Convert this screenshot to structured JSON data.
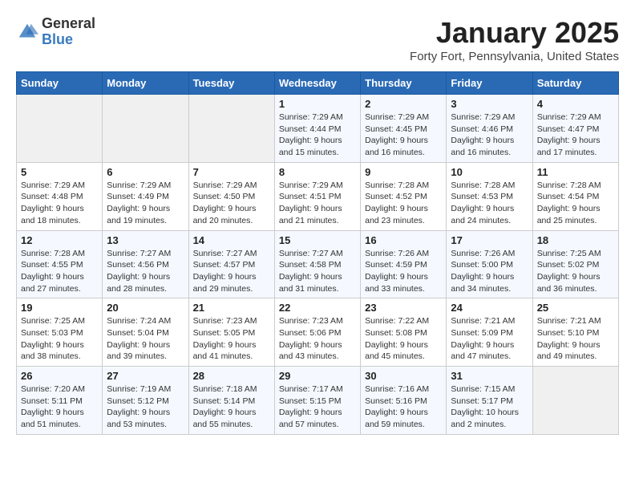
{
  "logo": {
    "general": "General",
    "blue": "Blue"
  },
  "title": "January 2025",
  "location": "Forty Fort, Pennsylvania, United States",
  "weekdays": [
    "Sunday",
    "Monday",
    "Tuesday",
    "Wednesday",
    "Thursday",
    "Friday",
    "Saturday"
  ],
  "weeks": [
    [
      {
        "day": "",
        "info": ""
      },
      {
        "day": "",
        "info": ""
      },
      {
        "day": "",
        "info": ""
      },
      {
        "day": "1",
        "info": "Sunrise: 7:29 AM\nSunset: 4:44 PM\nDaylight: 9 hours\nand 15 minutes."
      },
      {
        "day": "2",
        "info": "Sunrise: 7:29 AM\nSunset: 4:45 PM\nDaylight: 9 hours\nand 16 minutes."
      },
      {
        "day": "3",
        "info": "Sunrise: 7:29 AM\nSunset: 4:46 PM\nDaylight: 9 hours\nand 16 minutes."
      },
      {
        "day": "4",
        "info": "Sunrise: 7:29 AM\nSunset: 4:47 PM\nDaylight: 9 hours\nand 17 minutes."
      }
    ],
    [
      {
        "day": "5",
        "info": "Sunrise: 7:29 AM\nSunset: 4:48 PM\nDaylight: 9 hours\nand 18 minutes."
      },
      {
        "day": "6",
        "info": "Sunrise: 7:29 AM\nSunset: 4:49 PM\nDaylight: 9 hours\nand 19 minutes."
      },
      {
        "day": "7",
        "info": "Sunrise: 7:29 AM\nSunset: 4:50 PM\nDaylight: 9 hours\nand 20 minutes."
      },
      {
        "day": "8",
        "info": "Sunrise: 7:29 AM\nSunset: 4:51 PM\nDaylight: 9 hours\nand 21 minutes."
      },
      {
        "day": "9",
        "info": "Sunrise: 7:28 AM\nSunset: 4:52 PM\nDaylight: 9 hours\nand 23 minutes."
      },
      {
        "day": "10",
        "info": "Sunrise: 7:28 AM\nSunset: 4:53 PM\nDaylight: 9 hours\nand 24 minutes."
      },
      {
        "day": "11",
        "info": "Sunrise: 7:28 AM\nSunset: 4:54 PM\nDaylight: 9 hours\nand 25 minutes."
      }
    ],
    [
      {
        "day": "12",
        "info": "Sunrise: 7:28 AM\nSunset: 4:55 PM\nDaylight: 9 hours\nand 27 minutes."
      },
      {
        "day": "13",
        "info": "Sunrise: 7:27 AM\nSunset: 4:56 PM\nDaylight: 9 hours\nand 28 minutes."
      },
      {
        "day": "14",
        "info": "Sunrise: 7:27 AM\nSunset: 4:57 PM\nDaylight: 9 hours\nand 29 minutes."
      },
      {
        "day": "15",
        "info": "Sunrise: 7:27 AM\nSunset: 4:58 PM\nDaylight: 9 hours\nand 31 minutes."
      },
      {
        "day": "16",
        "info": "Sunrise: 7:26 AM\nSunset: 4:59 PM\nDaylight: 9 hours\nand 33 minutes."
      },
      {
        "day": "17",
        "info": "Sunrise: 7:26 AM\nSunset: 5:00 PM\nDaylight: 9 hours\nand 34 minutes."
      },
      {
        "day": "18",
        "info": "Sunrise: 7:25 AM\nSunset: 5:02 PM\nDaylight: 9 hours\nand 36 minutes."
      }
    ],
    [
      {
        "day": "19",
        "info": "Sunrise: 7:25 AM\nSunset: 5:03 PM\nDaylight: 9 hours\nand 38 minutes."
      },
      {
        "day": "20",
        "info": "Sunrise: 7:24 AM\nSunset: 5:04 PM\nDaylight: 9 hours\nand 39 minutes."
      },
      {
        "day": "21",
        "info": "Sunrise: 7:23 AM\nSunset: 5:05 PM\nDaylight: 9 hours\nand 41 minutes."
      },
      {
        "day": "22",
        "info": "Sunrise: 7:23 AM\nSunset: 5:06 PM\nDaylight: 9 hours\nand 43 minutes."
      },
      {
        "day": "23",
        "info": "Sunrise: 7:22 AM\nSunset: 5:08 PM\nDaylight: 9 hours\nand 45 minutes."
      },
      {
        "day": "24",
        "info": "Sunrise: 7:21 AM\nSunset: 5:09 PM\nDaylight: 9 hours\nand 47 minutes."
      },
      {
        "day": "25",
        "info": "Sunrise: 7:21 AM\nSunset: 5:10 PM\nDaylight: 9 hours\nand 49 minutes."
      }
    ],
    [
      {
        "day": "26",
        "info": "Sunrise: 7:20 AM\nSunset: 5:11 PM\nDaylight: 9 hours\nand 51 minutes."
      },
      {
        "day": "27",
        "info": "Sunrise: 7:19 AM\nSunset: 5:12 PM\nDaylight: 9 hours\nand 53 minutes."
      },
      {
        "day": "28",
        "info": "Sunrise: 7:18 AM\nSunset: 5:14 PM\nDaylight: 9 hours\nand 55 minutes."
      },
      {
        "day": "29",
        "info": "Sunrise: 7:17 AM\nSunset: 5:15 PM\nDaylight: 9 hours\nand 57 minutes."
      },
      {
        "day": "30",
        "info": "Sunrise: 7:16 AM\nSunset: 5:16 PM\nDaylight: 9 hours\nand 59 minutes."
      },
      {
        "day": "31",
        "info": "Sunrise: 7:15 AM\nSunset: 5:17 PM\nDaylight: 10 hours\nand 2 minutes."
      },
      {
        "day": "",
        "info": ""
      }
    ]
  ]
}
